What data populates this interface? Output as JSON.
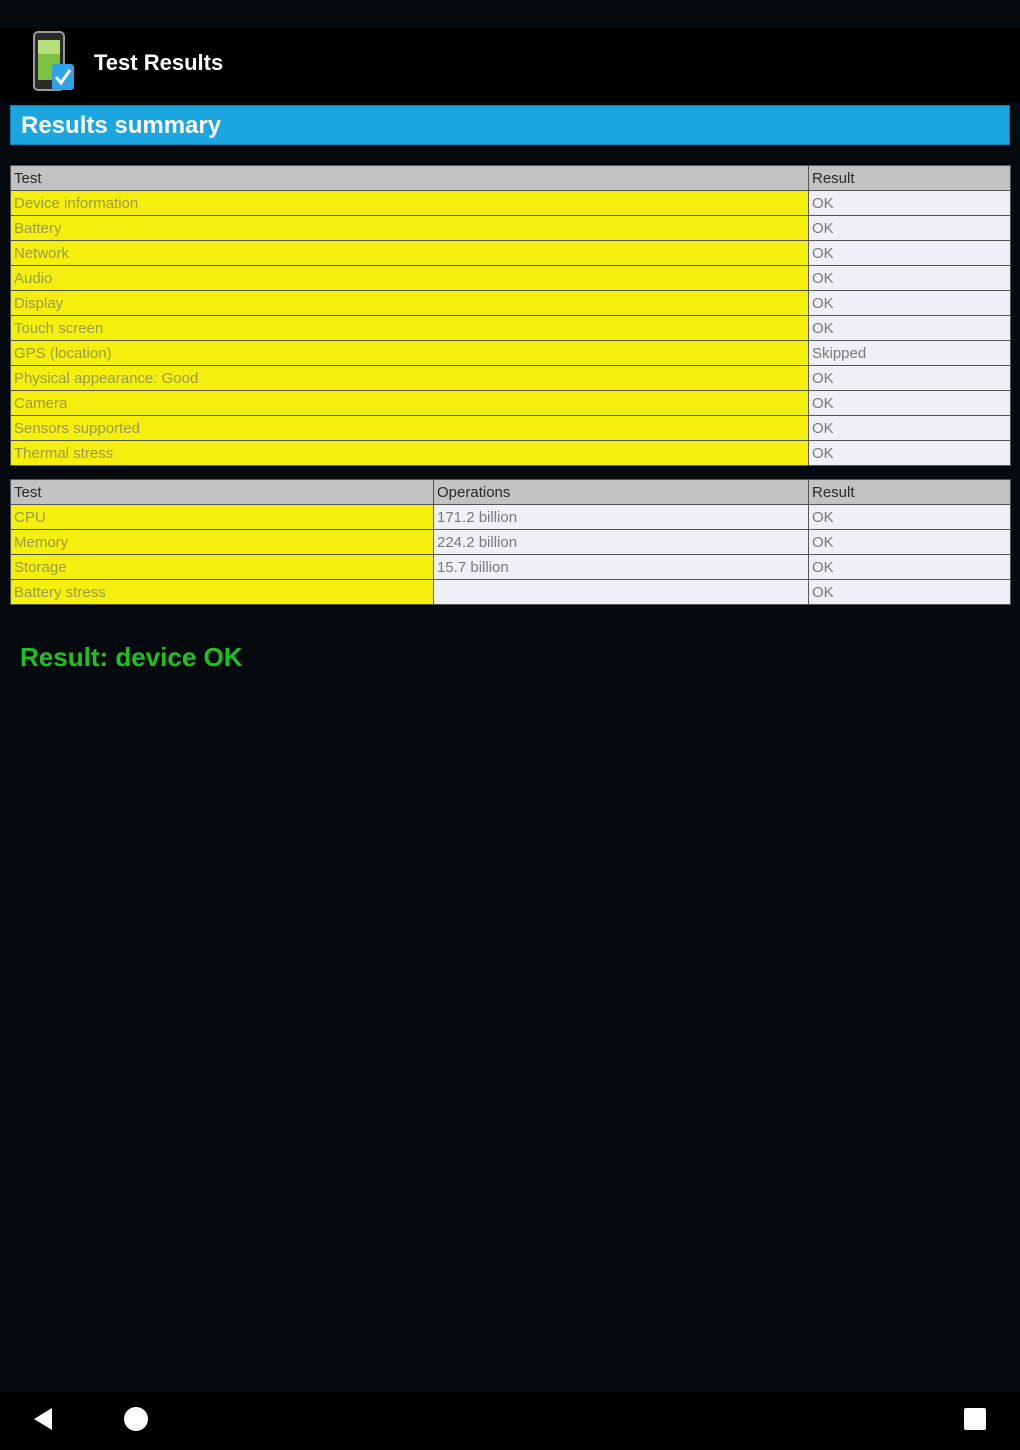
{
  "app": {
    "title": "Test Results",
    "icon": "phone-checkmark-icon"
  },
  "section": {
    "title": "Results summary"
  },
  "table1": {
    "headers": [
      "Test",
      "Result"
    ],
    "rows": [
      {
        "test": "Device information",
        "result": "OK"
      },
      {
        "test": "Battery",
        "result": "OK"
      },
      {
        "test": "Network",
        "result": "OK"
      },
      {
        "test": "Audio",
        "result": "OK"
      },
      {
        "test": "Display",
        "result": "OK"
      },
      {
        "test": "Touch screen",
        "result": "OK"
      },
      {
        "test": "GPS (location)",
        "result": "Skipped"
      },
      {
        "test": "Physical appearance: Good",
        "result": "OK"
      },
      {
        "test": "Camera",
        "result": "OK"
      },
      {
        "test": "Sensors supported",
        "result": "OK"
      },
      {
        "test": "Thermal stress",
        "result": "OK"
      }
    ]
  },
  "table2": {
    "headers": [
      "Test",
      "Operations",
      "Result"
    ],
    "rows": [
      {
        "test": "CPU",
        "operations": "171.2 billion",
        "result": "OK"
      },
      {
        "test": "Memory",
        "operations": "224.2 billion",
        "result": "OK"
      },
      {
        "test": "Storage",
        "operations": "15.7 billion",
        "result": "OK"
      },
      {
        "test": "Battery stress",
        "operations": "",
        "result": "OK"
      }
    ]
  },
  "summary": {
    "result_text": "Result: device OK"
  },
  "colors": {
    "header_bar": "#1ba6e0",
    "name_cell": "#f4ef0c",
    "value_cell": "#eef0f5",
    "column_header": "#c2c2c2",
    "result_ok": "#1ec21e",
    "background": "#050a0e"
  },
  "nav": {
    "back": "back-icon",
    "home": "home-icon",
    "recents": "recents-icon"
  }
}
